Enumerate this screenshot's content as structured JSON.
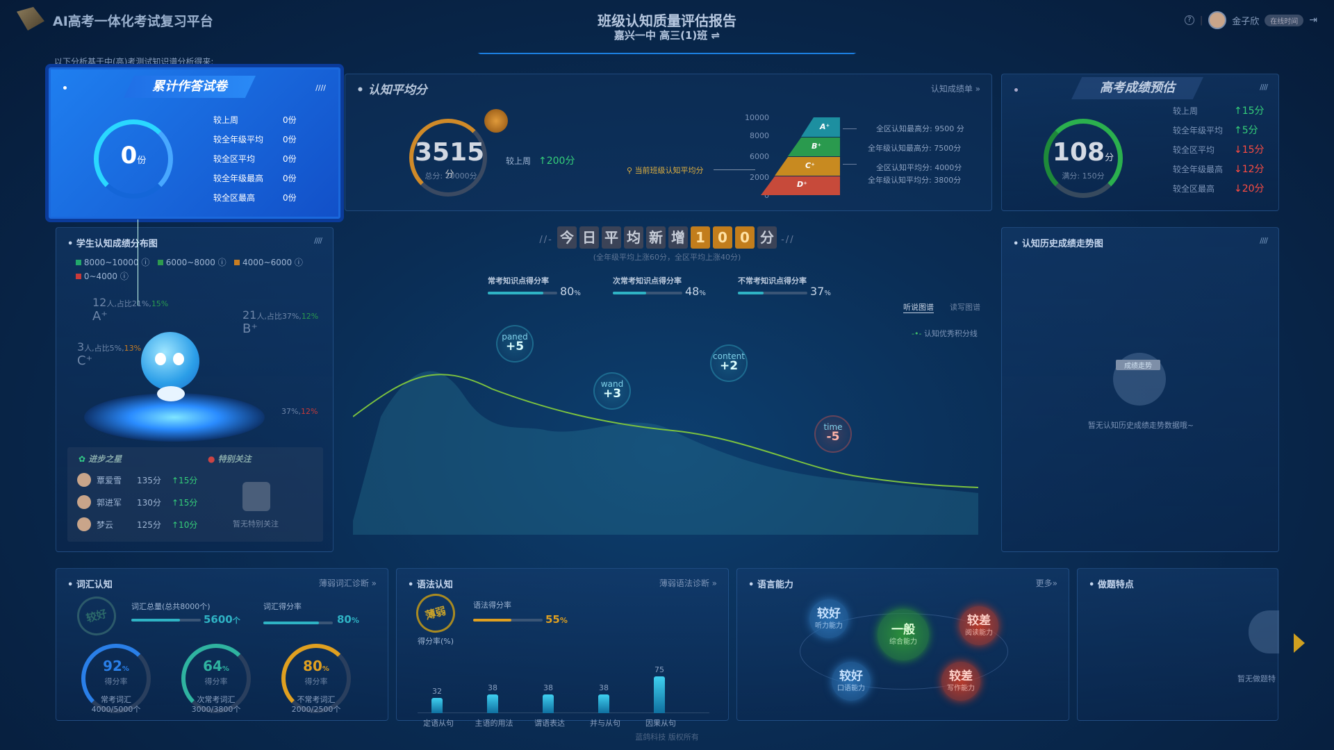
{
  "header": {
    "app_title": "AI高考一体化考试复习平台",
    "report_title": "班级认知质量评估报告",
    "class_name": "嘉兴一中 高三(1)班 ⇌",
    "user_name": "金子欣",
    "badge": "在线时间"
  },
  "intro": "以下分析基于中(高)考测试知识谱分析得来:",
  "cum": {
    "title": "累计作答试卷",
    "value": "0",
    "unit": "份",
    "rows": [
      {
        "label": "较上周",
        "value": "0份"
      },
      {
        "label": "较全年级平均",
        "value": "0份"
      },
      {
        "label": "较全区平均",
        "value": "0份"
      },
      {
        "label": "较全年级最高",
        "value": "0份"
      },
      {
        "label": "较全区最高",
        "value": "0份"
      }
    ]
  },
  "avg": {
    "title": "认知平均分",
    "link": "认知成绩单 »",
    "score": "3515",
    "unit": "分",
    "total": "总分: 10000分",
    "week_label": "较上周",
    "week_value": "↑200分",
    "current_label": "当前班级认知平均分",
    "pyramid_ticks": [
      "10000",
      "8000",
      "6000",
      "2000",
      "0"
    ],
    "grades": [
      "A⁺",
      "B⁺",
      "C⁺",
      "D⁺"
    ],
    "notes": [
      "全区认知最高分: 9500 分",
      "全年级认知最高分: 7500分",
      "全区认知平均分: 4000分",
      "全年级认知平均分: 3800分"
    ]
  },
  "forecast": {
    "title": "高考成绩预估",
    "score": "108",
    "unit": "分",
    "total": "满分: 150分",
    "rows": [
      {
        "label": "较上周",
        "value": "↑15分",
        "c": "g"
      },
      {
        "label": "较全年级平均",
        "value": "↑5分",
        "c": "g"
      },
      {
        "label": "较全区平均",
        "value": "↓15分",
        "c": "r"
      },
      {
        "label": "较全年级最高",
        "value": "↓12分",
        "c": "r"
      },
      {
        "label": "较全区最高",
        "value": "↓20分",
        "c": "r"
      }
    ]
  },
  "dist": {
    "title": "学生认知成绩分布图",
    "legend": [
      "8000~10000",
      "6000~8000",
      "4000~6000",
      "0~4000"
    ],
    "legend_colors": [
      "#22a86b",
      "#2e9a4e",
      "#c87d22",
      "#c83a3a"
    ],
    "labels": [
      {
        "n": "12",
        "t": "人,占比21%,",
        "p": "15%",
        "g": "A⁺"
      },
      {
        "n": "21",
        "t": "人,占比37%,",
        "p": "12%",
        "g": "B⁺"
      },
      {
        "n": "3",
        "t": "人,占比5%,",
        "p": "13%",
        "g": "C⁺"
      },
      {
        "n": "",
        "t": "37%,",
        "p": "12%",
        "g": ""
      }
    ],
    "progress_title": "进步之星",
    "focus_title": "特别关注",
    "focus_empty": "暂无特别关注",
    "stars": [
      {
        "name": "覃爱雪",
        "score": "135分",
        "up": "↑15分"
      },
      {
        "name": "郭进军",
        "score": "130分",
        "up": "↑15分"
      },
      {
        "name": "梦云",
        "score": "125分",
        "up": "↑10分"
      }
    ]
  },
  "today": {
    "prefix": "今日平均新增",
    "digits": [
      "1",
      "0",
      "0"
    ],
    "suffix": "分",
    "sub": "(全年级平均上涨60分，全区平均上涨40分)",
    "rates": [
      {
        "label": "常考知识点得分率",
        "value": "80",
        "pct": 80
      },
      {
        "label": "次常考知识点得分率",
        "value": "48",
        "pct": 48
      },
      {
        "label": "不常考知识点得分率",
        "value": "37",
        "pct": 37
      }
    ],
    "tabs": [
      "听说图谱",
      "读写图谱"
    ],
    "legend": "认知优秀积分线",
    "tags": [
      {
        "w": "paned",
        "v": "+5"
      },
      {
        "w": "wand",
        "v": "+3"
      },
      {
        "w": "content",
        "v": "+2"
      },
      {
        "w": "time",
        "v": "-5"
      }
    ]
  },
  "history": {
    "title": "认知历史成绩走势图",
    "icon_label": "成绩走势",
    "empty": "暂无认知历史成绩走势数据哦~"
  },
  "vocab": {
    "title": "词汇认知",
    "link": "薄弱词汇诊断 »",
    "grade": "较好",
    "total_label": "词汇总量(总共8000个)",
    "total_value": "5600",
    "total_unit": "个",
    "total_pct": 70,
    "rate_label": "词汇得分率",
    "rate_value": "80",
    "rate_pct": 80,
    "gauges": [
      {
        "v": "92",
        "l": "得分率",
        "name": "常考词汇",
        "count": "4000/5000个"
      },
      {
        "v": "64",
        "l": "得分率",
        "name": "次常考词汇",
        "count": "3000/3800个"
      },
      {
        "v": "80",
        "l": "得分率",
        "name": "不常考词汇",
        "count": "2000/2500个"
      }
    ]
  },
  "grammar": {
    "title": "语法认知",
    "link": "薄弱语法诊断 »",
    "grade": "薄弱",
    "grade_label": "得分率(%)",
    "rate_label": "语法得分率",
    "rate_value": "55",
    "rate_pct": 55,
    "bars": [
      {
        "v": "32",
        "name": "定语从句"
      },
      {
        "v": "38",
        "name": "主语的用法"
      },
      {
        "v": "38",
        "name": "谓语表达"
      },
      {
        "v": "38",
        "name": "并与从句"
      },
      {
        "v": "75",
        "name": "因果从句"
      }
    ]
  },
  "ability": {
    "title": "语言能力",
    "link": "更多»",
    "items": [
      {
        "g": "较好",
        "n": "听力能力"
      },
      {
        "g": "一般",
        "n": "综合能力"
      },
      {
        "g": "较差",
        "n": "阅读能力"
      },
      {
        "g": "较好",
        "n": "口语能力"
      },
      {
        "g": "较差",
        "n": "写作能力"
      }
    ]
  },
  "traits": {
    "title": "做题特点",
    "empty": "暂无做题特"
  },
  "footer": "蓝鸽科技 版权所有"
}
